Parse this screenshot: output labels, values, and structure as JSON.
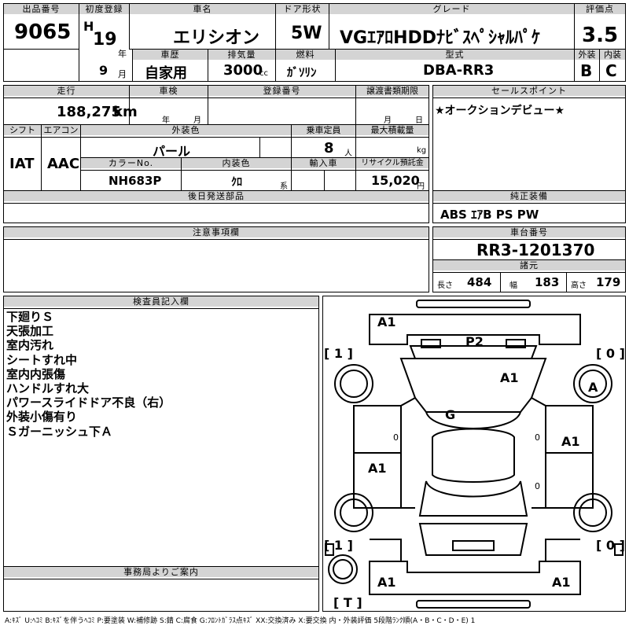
{
  "header": {
    "lot_no_label": "出品番号",
    "lot_no": "9065",
    "first_reg_label": "初度登録",
    "era": "H",
    "year": "19",
    "year_unit": "年",
    "month": "9",
    "month_unit": "月",
    "car_name_label": "車名",
    "car_name": "エリシオン",
    "door_label": "ドア形状",
    "door": "5W",
    "grade_label": "グレード",
    "grade": "VGｴｱﾛHDDﾅﾋﾞｽﾍﾟｼｬﾙﾊﾟｹ",
    "score_label": "評価点",
    "score": "3.5",
    "usage_label": "車歴",
    "usage": "自家用",
    "displacement_label": "排気量",
    "displacement": "3000",
    "displacement_unit": "cc",
    "fuel_label": "燃料",
    "fuel": "ｶﾞｿﾘﾝ",
    "model_label": "型式",
    "model": "DBA-RR3",
    "exterior_label": "外装",
    "exterior": "B",
    "interior_label": "内装",
    "interior": "C"
  },
  "row2": {
    "mileage_label": "走行",
    "mileage": "188,275",
    "mileage_unit": "km",
    "inspection_label": "車検",
    "insp_year_unit": "年",
    "insp_month_unit": "月",
    "reg_no_label": "登録番号",
    "deadline_label": "譲渡書類期限",
    "deadline_month_unit": "月",
    "deadline_day_unit": "日",
    "sales_point_label": "セールスポイント",
    "sales_point": "★オークションデビュー★"
  },
  "row3": {
    "shift_label": "シフト",
    "shift": "IAT",
    "aircon_label": "エアコン",
    "aircon": "AAC",
    "ext_color_label": "外装色",
    "ext_color": "パール",
    "capacity_label": "乗車定員",
    "capacity": "8",
    "capacity_unit": "人",
    "max_load_label": "最大積載量",
    "max_load_unit": "kg",
    "color_no_label": "カラーNo.",
    "color_no": "NH683P",
    "int_color_label": "内装色",
    "int_color": "ｸﾛ",
    "int_color_unit": "系",
    "import_label": "輸入車",
    "recycle_label": "リサイクル預託金",
    "recycle": "15,020",
    "recycle_unit": "円",
    "later_parts_label": "後日発送部品",
    "equipment_label": "純正装備",
    "equipment": "ABS ｴｱB PS PW"
  },
  "notes_section": {
    "caution_label": "注意事項欄",
    "chassis_label": "車台番号",
    "chassis": "RR3-1201370",
    "specs_label": "諸元",
    "length_label": "長さ",
    "length": "484",
    "width_label": "幅",
    "width": "183",
    "height_label": "高さ",
    "height": "179",
    "inspector_label": "検査員記入欄",
    "inspector_notes": [
      "下廻りＳ",
      "天張加工",
      "室内汚れ",
      "シートすれ中",
      "室内内張傷",
      "ハンドルすれ大",
      "パワースライドドア不良（右）",
      "外装小傷有り",
      "Ｓガーニッシュ下Ａ"
    ],
    "office_label": "事務局よりご案内"
  },
  "diagram": {
    "marks": [
      "A1",
      "P2",
      "A1",
      "A",
      "G",
      "A1",
      "A1",
      "A1",
      "A1",
      "0",
      "0",
      "0"
    ],
    "bracket_labels": [
      "[ 1 ]",
      "[ 0 ]",
      "[ 1 ]",
      "[ 0 ]",
      "[ T ]"
    ]
  },
  "legend": "A:ｷｽﾞ U:ﾍｺﾐ B:ｷｽﾞを伴うﾍｺﾐ P:要塗装 W:補修跡 S:錆 C:腐食 G:ﾌﾛﾝﾄｶﾞﾗｽ点ｷｽﾞ XX:交換済み X:要交換 内・外装評価 5段階ﾗﾝｸ順(A・B・C・D・E) 1"
}
